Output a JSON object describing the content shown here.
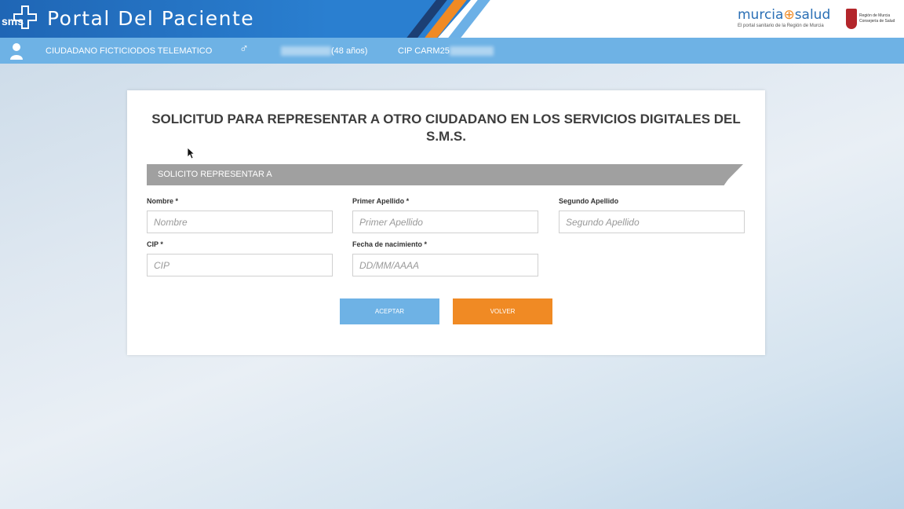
{
  "header": {
    "logo_text": "sms",
    "title": "Portal Del Paciente",
    "brand_left": "murcia",
    "brand_right": "salud",
    "brand_sub": "El portal sanitario de la Región de Murcia",
    "region_line1": "Región de Murcia",
    "region_line2": "Consejería de Salud"
  },
  "userbar": {
    "user_icon": "user-icon",
    "name": "CIUDADANO FICTICIODOS TELEMATICO",
    "gender_icon": "male-icon",
    "age": "(48 años)",
    "cip_label": "CIP CARM25"
  },
  "form": {
    "title": "SOLICITUD PARA REPRESENTAR A OTRO CIUDADANO EN LOS SERVICIOS DIGITALES DEL S.M.S.",
    "section": "SOLICITO REPRESENTAR A",
    "fields": {
      "nombre": {
        "label": "Nombre *",
        "placeholder": "Nombre",
        "value": ""
      },
      "primer_apellido": {
        "label": "Primer Apellido *",
        "placeholder": "Primer Apellido",
        "value": ""
      },
      "segundo_apellido": {
        "label": "Segundo Apellido",
        "placeholder": "Segundo Apellido",
        "value": ""
      },
      "cip": {
        "label": "CIP *",
        "placeholder": "CIP",
        "value": ""
      },
      "fecha": {
        "label": "Fecha de nacimiento *",
        "placeholder": "DD/MM/AAAA",
        "value": ""
      }
    },
    "accept_label": "ACEPTAR",
    "back_label": "VOLVER"
  },
  "colors": {
    "header_blue": "#1f66b5",
    "userbar_blue": "#6eb2e5",
    "accent_orange": "#f08a24",
    "section_gray": "#a0a0a0"
  }
}
